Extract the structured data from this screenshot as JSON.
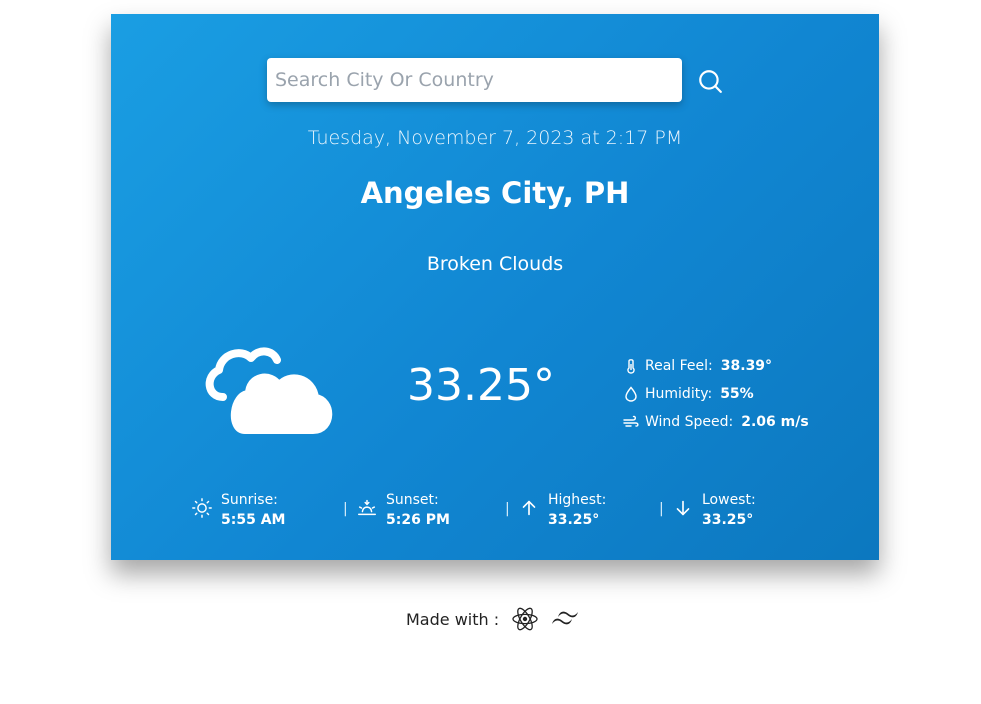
{
  "search": {
    "placeholder": "Search City Or Country",
    "icon": "search-icon"
  },
  "datetime": "Tuesday, November 7, 2023 at 2:17 PM",
  "location": "Angeles City, PH",
  "condition": "Broken Clouds",
  "weather_icon": "broken-clouds-icon",
  "temperature": "33.25°",
  "details": [
    {
      "icon": "thermometer-icon",
      "label": "Real Feel:",
      "value": "38.39°"
    },
    {
      "icon": "humidity-drop-icon",
      "label": "Humidity:",
      "value": "55%"
    },
    {
      "icon": "wind-icon",
      "label": "Wind Speed:",
      "value": "2.06 m/s"
    }
  ],
  "summary": [
    {
      "icon": "sunrise-icon",
      "label": "Sunrise:",
      "value": "5:55 AM"
    },
    {
      "icon": "sunset-icon",
      "label": "Sunset:",
      "value": "5:26 PM"
    },
    {
      "icon": "arrow-up-icon",
      "label": "Highest:",
      "value": "33.25°"
    },
    {
      "icon": "arrow-down-icon",
      "label": "Lowest:",
      "value": "33.25°"
    }
  ],
  "separator": "|",
  "footer": {
    "label": "Made with :",
    "icons": [
      "react-icon",
      "tailwind-icon"
    ]
  },
  "colors": {
    "card_gradient_start": "#1a9ee3",
    "card_gradient_end": "#0c78bf",
    "text": "#ffffff"
  }
}
